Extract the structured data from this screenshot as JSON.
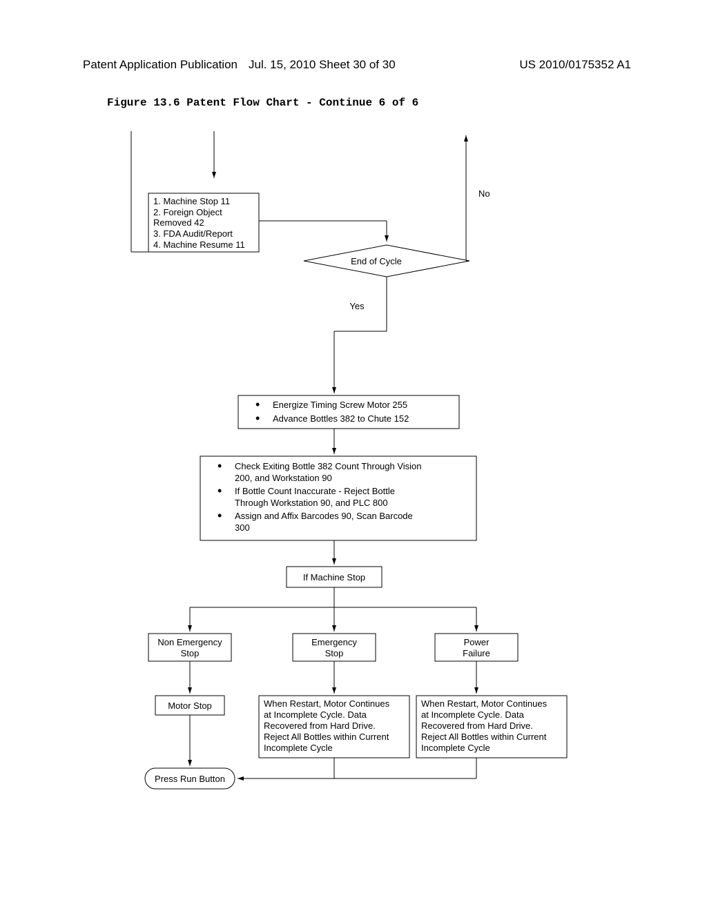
{
  "header": {
    "left": "Patent Application Publication",
    "mid": "Jul. 15, 2010  Sheet 30 of 30",
    "right": "US 2010/0175352 A1"
  },
  "figure_title": "Figure 13.6 Patent Flow Chart - Continue 6 of 6",
  "boxes": {
    "actions_list": {
      "l1": "1.  Machine Stop 11",
      "l2": "2.  Foreign Object",
      "l2b": "Removed 42",
      "l3": "3.  FDA Audit/Report",
      "l4": "4.  Machine Resume 11"
    },
    "decision": {
      "label": "End of Cycle",
      "no": "No",
      "yes": "Yes"
    },
    "energize": {
      "b1": "Energize Timing Screw Motor 255",
      "b2": "Advance Bottles 382 to Chute 152"
    },
    "check": {
      "b1a": "Check Exiting Bottle 382 Count Through Vision",
      "b1b": "200, and Workstation 90",
      "b2a": "If Bottle Count Inaccurate  -  Reject Bottle",
      "b2b": "Through Workstation 90, and PLC 800",
      "b3a": "Assign and Affix Barcodes 90, Scan Barcode",
      "b3b": "300"
    },
    "if_stop": "If Machine Stop",
    "non_em": {
      "l1": "Non Emergency",
      "l2": "Stop"
    },
    "em": {
      "l1": "Emergency",
      "l2": "Stop"
    },
    "power": {
      "l1": "Power",
      "l2": "Failure"
    },
    "motor_stop": "Motor Stop",
    "restart": {
      "l1": "When Restart, Motor Continues",
      "l2": "at Incomplete Cycle. Data",
      "l3": "Recovered from Hard Drive.",
      "l4": "Reject All Bottles within Current",
      "l5": "Incomplete Cycle"
    },
    "press_run": "Press Run Button"
  }
}
